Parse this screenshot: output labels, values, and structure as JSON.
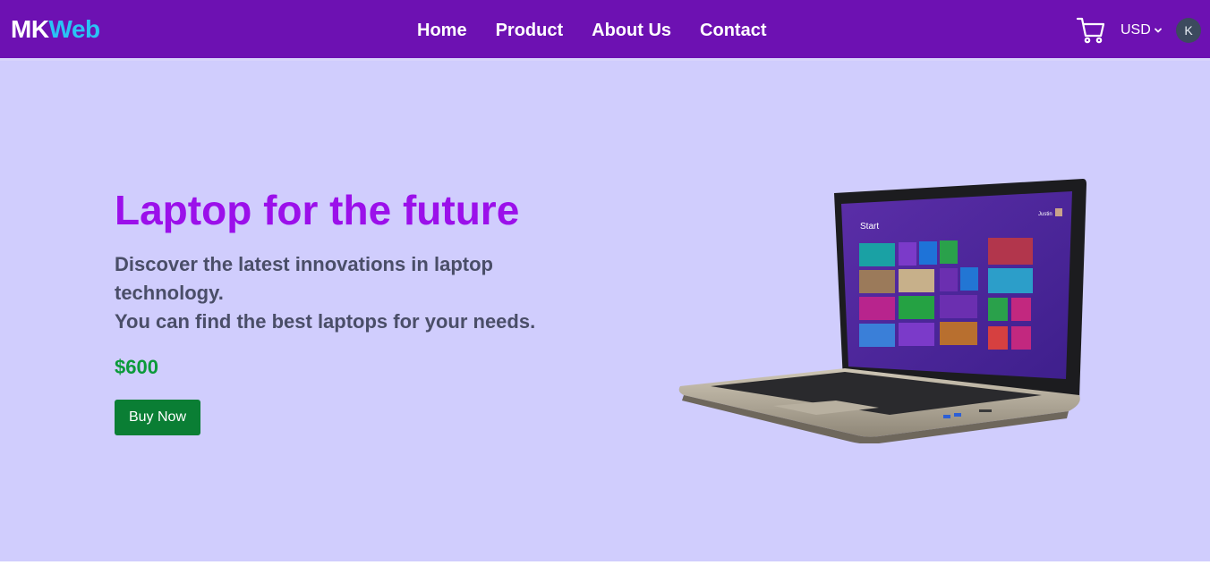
{
  "header": {
    "logo_part1": "MK",
    "logo_part2": "Web",
    "nav": [
      "Home",
      "Product",
      "About Us",
      "Contact"
    ],
    "currency": "USD",
    "avatar_initial": "K",
    "cart_icon": "shopping-cart-icon"
  },
  "hero": {
    "title": "Laptop for the future",
    "description_line1": "Discover the latest innovations in laptop technology.",
    "description_line2": "You can find the best laptops for your needs.",
    "price": "$600",
    "buy_label": "Buy Now"
  },
  "laptop_screen": {
    "start_label": "Start",
    "user_label": "Justin"
  },
  "colors": {
    "navbar": "#6d11b2",
    "background": "#d0cdfd",
    "title": "#9b10ea",
    "price": "#0b9a3a",
    "button": "#0a7e34"
  }
}
